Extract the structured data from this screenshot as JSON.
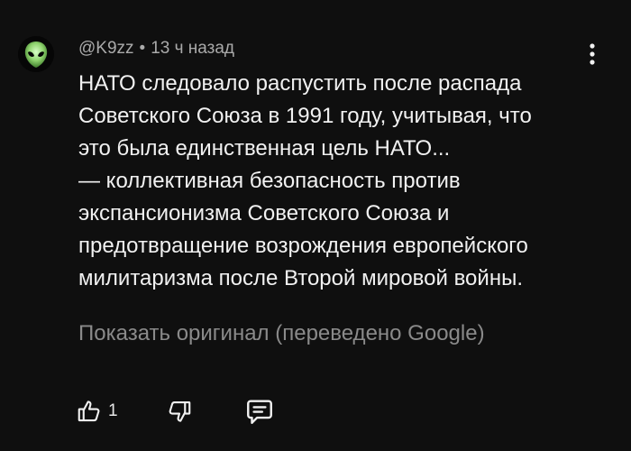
{
  "comment": {
    "author": "@K9zz",
    "separator": "•",
    "time": "13 ч назад",
    "avatar_icon": "alien-head-icon",
    "lines": [
      "НАТО следовало распустить после распада",
      "Советского Союза в 1991 году, учитывая, что",
      "это была единственная цель НАТО...",
      "— коллективная безопасность против",
      "экспансионизма Советского Союза и",
      "предотвращение возрождения европейского",
      "милитаризма после Второй мировой войны."
    ],
    "translation_link": "Показать оригинал (переведено Google)",
    "actions": {
      "like_icon": "thumbs-up-icon",
      "like_count": "1",
      "dislike_icon": "thumbs-down-icon",
      "reply_icon": "reply-comment-icon",
      "menu_icon": "more-vertical-icon"
    }
  },
  "colors": {
    "background": "#0f0f0f",
    "text": "#f1f1f1",
    "meta": "#aaaaaa",
    "link": "#8a8a8a",
    "avatar_accent": "#a6f08a"
  }
}
